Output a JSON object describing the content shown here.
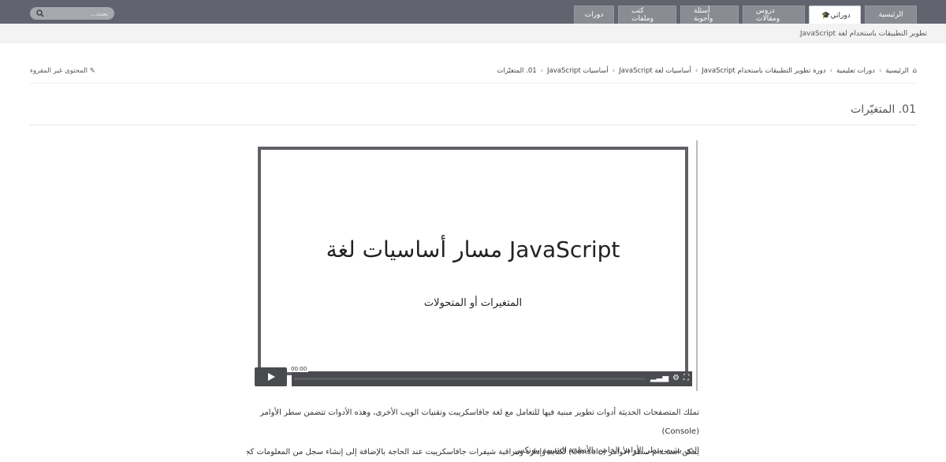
{
  "nav": {
    "search_placeholder": "بحث...",
    "tabs": [
      {
        "label": "الرئيسية"
      },
      {
        "label": "دوراتي",
        "icon": "graduation-cap-icon"
      },
      {
        "label": "دروس ومقالات"
      },
      {
        "label": "أسئلة وأجوبة"
      },
      {
        "label": "كتب وملفات"
      },
      {
        "label": "دورات"
      }
    ]
  },
  "subnav": {
    "course": "تطوير التطبيقات باستخدام لغة JavaScript"
  },
  "breadcrumb": [
    "الرئيسية",
    "دورات تعليمية",
    "دورة تطوير التطبيقات باستخدام JavaScript",
    "أساسيات لغة JavaScript",
    "أساسيات JavaScript",
    "01. المتغيّرات"
  ],
  "unread_link": "المحتوى غير المقروء",
  "page_title": "01. المتغيّرات",
  "video": {
    "title": "مسار أساسيات لغة JavaScript",
    "subtitle": "المتغيرات أو المتحولات",
    "time": "00:00",
    "progress": 0
  },
  "content": {
    "p1_line1": "تملك المتصفحات الحديثة أدوات تطوير مبنية فيها للتعامل مع لغة جافاسكريبت وتقنيات الويب الأخرى، وهذه الأدوات تتضمن سطر الأوامر (Console)",
    "p1_line2": "الذي يشبه سطر الأوامر الخاص بالأنظمة الشبيهة بيونكس.",
    "p2": "يمكن استخدام سطر الأوامر (Console) لكتابة وإدارة ومراقبة شيفرات جافاسكريبت عند الحاجة بالإضافة إلى إنشاء سجل من المعلومات كجزء من عملية"
  }
}
